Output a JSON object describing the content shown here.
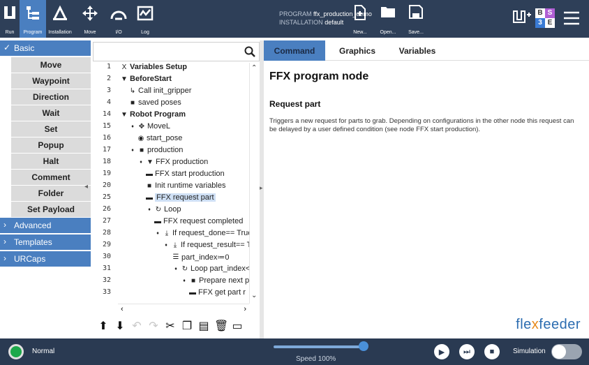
{
  "topbar": {
    "run_label": "Run",
    "program_label": "Program",
    "installation_label": "Installation",
    "move_label": "Move",
    "io_label": "I/O",
    "log_label": "Log",
    "program_key": "PROGRAM",
    "program_value": "ffx_production_demo",
    "installation_key": "INSTALLATION",
    "installation_value": "default",
    "new_label": "New...",
    "open_label": "Open...",
    "save_label": "Save...",
    "safety_badge": [
      "B",
      "S",
      "3",
      "E"
    ]
  },
  "sidebar": {
    "basic": "Basic",
    "items": [
      "Move",
      "Waypoint",
      "Direction",
      "Wait",
      "Set",
      "Popup",
      "Halt",
      "Comment",
      "Folder",
      "Set Payload"
    ],
    "advanced": "Advanced",
    "templates": "Templates",
    "urcaps": "URCaps"
  },
  "search": {
    "placeholder": ""
  },
  "tree": [
    {
      "ln": "1",
      "icon": "X",
      "text": "Variables Setup",
      "bold": true
    },
    {
      "ln": "2",
      "icon": "▼",
      "text": "BeforeStart",
      "bold": true
    },
    {
      "ln": "3",
      "icon": "↳",
      "text": "Call init_gripper"
    },
    {
      "ln": "4",
      "icon": "■",
      "text": "saved poses"
    },
    {
      "ln": "14",
      "icon": "▼",
      "text": "Robot Program",
      "bold": true
    },
    {
      "ln": "15",
      "icon": "✥",
      "text": "MoveL"
    },
    {
      "ln": "16",
      "icon": "◉",
      "text": "start_pose"
    },
    {
      "ln": "17",
      "icon": "■",
      "text": "production"
    },
    {
      "ln": "18",
      "icon": "▼",
      "text": "FFX production"
    },
    {
      "ln": "19",
      "icon": "▬",
      "text": "FFX start production"
    },
    {
      "ln": "20",
      "icon": "■",
      "text": "Init runtime variables"
    },
    {
      "ln": "25",
      "icon": "▬",
      "text": "FFX request part"
    },
    {
      "ln": "26",
      "icon": "↻",
      "text": "Loop"
    },
    {
      "ln": "27",
      "icon": "▬",
      "text": "FFX request completed"
    },
    {
      "ln": "28",
      "icon": "⤓",
      "text": "If request_done== True"
    },
    {
      "ln": "29",
      "icon": "⤓",
      "text": "If request_result== T"
    },
    {
      "ln": "30",
      "icon": "☰",
      "text": "part_index≔0"
    },
    {
      "ln": "31",
      "icon": "↻",
      "text": "Loop part_index<"
    },
    {
      "ln": "32",
      "icon": "■",
      "text": "Prepare next pa"
    },
    {
      "ln": "33",
      "icon": "▬",
      "text": "FFX get part r"
    }
  ],
  "tabs": [
    "Command",
    "Graphics",
    "Variables"
  ],
  "node": {
    "title": "FFX program node",
    "subtitle": "Request part",
    "description": "Triggers a new request for parts to grab. Depending on configurations in the other node this request can be delayed by a user defined condition (see node FFX start production)."
  },
  "logo": {
    "part1": "fle",
    "part2": "x",
    "part3": "feeder"
  },
  "bottom": {
    "status": "Normal",
    "speed": "Speed 100%",
    "speed_value": 100,
    "simulation": "Simulation"
  },
  "colors": {
    "topbar": "#2e3f58",
    "accent": "#4a7fc0",
    "selected": "#cfe0f5",
    "status_ok": "#1ca84a"
  }
}
